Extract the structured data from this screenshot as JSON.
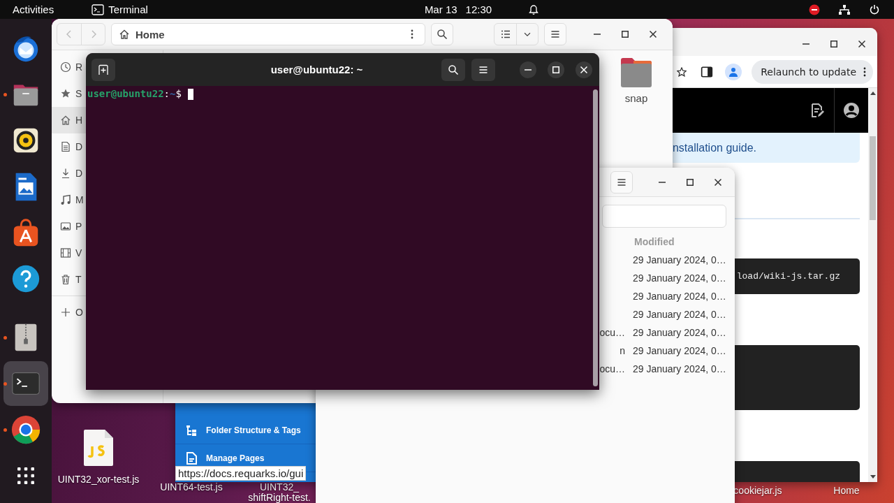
{
  "top_bar": {
    "activities": "Activities",
    "app_name": "Terminal",
    "date": "Mar 13",
    "time": "12:30"
  },
  "dock": [
    {
      "kind": "thunderbird",
      "running": false,
      "selected": false
    },
    {
      "kind": "files",
      "running": true,
      "selected": false
    },
    {
      "kind": "rhythmbox",
      "running": false,
      "selected": false
    },
    {
      "kind": "writer",
      "running": false,
      "selected": false
    },
    {
      "kind": "appcenter",
      "running": false,
      "selected": false
    },
    {
      "kind": "help",
      "running": false,
      "selected": false
    },
    {
      "kind": "archive",
      "running": true,
      "selected": false
    },
    {
      "kind": "terminal",
      "running": true,
      "selected": true
    },
    {
      "kind": "chrome",
      "running": true,
      "selected": false
    },
    {
      "kind": "apps",
      "running": false,
      "selected": false
    }
  ],
  "desktop_icons": [
    {
      "kind": "js",
      "label": "UINT32_xor-test.js"
    },
    {
      "kind": "label",
      "label": "UINT64-test.js"
    },
    {
      "kind": "label",
      "label": "UINT32_shiftRight-test."
    },
    {
      "kind": "label",
      "label": "cookiejar.js"
    },
    {
      "kind": "label",
      "label": "Home"
    }
  ],
  "browser": {
    "relaunch": "Relaunch to update",
    "banner": "nstallation guide.",
    "code_blocks": [
      {
        "kind": "text",
        "text": "load/wiki-js.tar.gz"
      },
      {
        "kind": "blank"
      },
      {
        "kind": "blank"
      }
    ],
    "nav": [
      {
        "kind": "tree",
        "label": "Folder Structure & Tags"
      },
      {
        "kind": "page",
        "label": "Manage Pages"
      }
    ],
    "status_url": "https://docs.requarks.io/gui"
  },
  "files_home": {
    "path": "Home",
    "sidebar": [
      {
        "kind": "recent",
        "label": "R",
        "selected": false
      },
      {
        "kind": "starred",
        "label": "S",
        "selected": false
      },
      {
        "kind": "home",
        "label": "H",
        "selected": true
      },
      {
        "kind": "documents",
        "label": "D",
        "selected": false
      },
      {
        "kind": "downloads",
        "label": "D",
        "selected": false
      },
      {
        "kind": "music",
        "label": "M",
        "selected": false
      },
      {
        "kind": "pictures",
        "label": "P",
        "selected": false
      },
      {
        "kind": "videos",
        "label": "V",
        "selected": false
      },
      {
        "kind": "trash",
        "label": "T",
        "selected": false
      },
      {
        "kind": "other",
        "label": "O",
        "selected": false
      }
    ],
    "items": [
      {
        "name": "snap"
      }
    ]
  },
  "files_second": {
    "columns": {
      "modified": "Modified"
    },
    "rows": [
      {
        "modified": "29 January 2024, 0…"
      },
      {
        "modified": "29 January 2024, 0…"
      },
      {
        "modified": "29 January 2024, 0…"
      },
      {
        "modified": "29 January 2024, 0…"
      },
      {
        "name": "ocu…",
        "modified": "29 January 2024, 0…"
      },
      {
        "name": "n",
        "modified": "29 January 2024, 0…"
      },
      {
        "name": "ocu…",
        "modified": "29 January 2024, 0…"
      }
    ]
  },
  "terminal": {
    "title": "user@ubuntu22: ~",
    "prompt": {
      "user": "user@ubuntu22",
      "colon": ":",
      "path": "~",
      "sign": "$"
    }
  }
}
